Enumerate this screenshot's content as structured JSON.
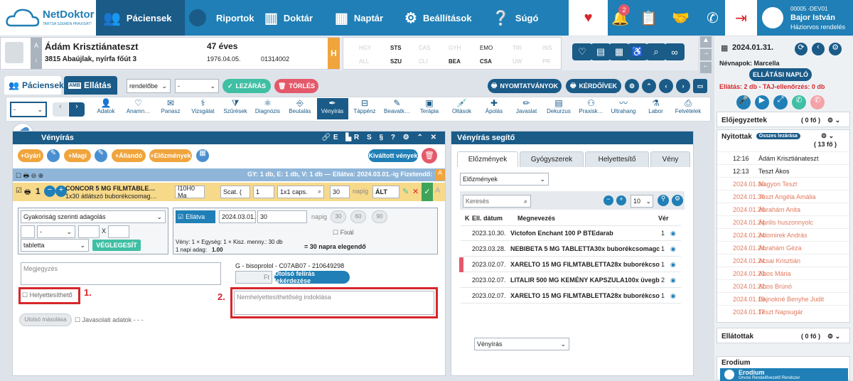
{
  "nav": {
    "logo": "NetDoktor",
    "logo_sub": "TARTSA SZEMÉN PRAXISÁT!",
    "items": [
      "Páciensek",
      "Riportok",
      "Doktár",
      "Naptár",
      "Beállítások",
      "Súgó"
    ],
    "badge": "2",
    "user_id": "00005 -DEV01",
    "user_name": "Bajor István",
    "user_role": "Háziorvos rendelés"
  },
  "patient": {
    "name": "Ádám Krisztiánateszt",
    "address": "3815 Abaújlak, nyírfa főút 3",
    "age": "47 éves",
    "dob": "1976.04.05.",
    "taj": "01314002",
    "h": "H"
  },
  "vitals": {
    "row1": [
      "HGY",
      "STS",
      "CAS",
      "GYH",
      "EMO",
      "TRI",
      "INS"
    ],
    "row2": [
      "ALL",
      "SZU",
      "CLI",
      "BEA",
      "CSA",
      "UW",
      "PR"
    ],
    "active1": [
      1,
      4
    ],
    "active2": [
      1,
      3,
      4
    ]
  },
  "tabs": {
    "pacients": "Páciensek",
    "ellatas": "Ellátás",
    "amb": "AMB",
    "select1": "rendelőbe",
    "select2": "-",
    "lezaras": "LEZÁRÁS",
    "torles": "TÖRLÉS",
    "nyomtatvanyok": "NYOMTATVÁNYOK",
    "kerdoivek": "KÉRDŐÍVEK",
    "sel3": "-"
  },
  "tools": [
    "Adatok",
    "Anamn…",
    "Panasz",
    "Vizsgálat",
    "Szűrések",
    "Diagnózis",
    "Beutalás",
    "Vényírás",
    "Táppénz",
    "Beavatk…",
    "Terápia",
    "Oltások",
    "Ápolás",
    "Javaslat",
    "Dekurzus",
    "Praxisk…",
    "Ultrahang",
    "Labor",
    "Felvételek"
  ],
  "ven": {
    "title": "Vényírás",
    "btns": [
      "+Gyári",
      "+Magi",
      "+Állandó",
      "+Előzmények"
    ],
    "kivalt": "Kiváltott vények",
    "summary": "GY: 1 db, E: 1 db, V: 1 db — Ellátva: 2024.03.01.-ig  Fizetendő: ?",
    "drug_name": "CONCOR 5 MG FILMTABLE…",
    "drug_sub": "1x30 átlátszó buborékcsomag…",
    "qty": "1",
    "code": "I10H0 Ma",
    "scat": "Scat. (",
    "n": "1",
    "caps": "1x1 caps.",
    "days": "30",
    "napig": "napig",
    "alt": "ÁLT",
    "dose": "Gyakoriság szerinti adagolás",
    "x": "X",
    "form": "tabletta",
    "veglegesit": "VÉGLEGESÍT",
    "ellatva": "Ellátva",
    "date": "2024.03.01.",
    "d30": "30",
    "p30": "30",
    "p60": "60",
    "p90": "90",
    "fixal": "Fixál",
    "veny_line": "Vény: 1 × Egység: 1 × Kisz. menny.: 30 db",
    "napi": "1 napi adag:",
    "napi_val": "1.00",
    "elegendo": "= 30 napra elegendő",
    "megjegyzes": "Megjegyzés",
    "atc": "G - bisoprolol - C07AB07 - 210649298",
    "ft": "Ft",
    "utolso": "Utolsó felírás lekérdezése",
    "helyettesitheto": "Helyettesíthető",
    "nem_indok": "Nemhelyettesíthetőség indoklása",
    "utolso_masolasa": "Utolsó másolása",
    "javasolati": "Javasolati adatok - - -",
    "m1": "1.",
    "m2": "2."
  },
  "seg": {
    "title": "Vényírás segítő",
    "tabs": [
      "Előzmények",
      "Gyógyszerek",
      "Helyettesítő",
      "Vény"
    ],
    "sel": "Előzmények",
    "search": "Keresés",
    "perpage": "10",
    "col_k": "K",
    "col_date": "Ell. dátum",
    "col_name": "Megnevezés",
    "col_ver": "Vér",
    "rows": [
      {
        "date": "2023.10.30.",
        "name": "Victofon Enchant 100 P BTEdarab",
        "n": "1"
      },
      {
        "date": "2023.03.28.",
        "name": "NEBIBETA 5 MG TABLETTA30x buborékcsomagc",
        "n": "1"
      },
      {
        "date": "2023.02.07.",
        "name": "XARELTO 15 MG FILMTABLETTA28x buborékcso",
        "n": "1"
      },
      {
        "date": "2023.02.07.",
        "name": "LITALIR 500 MG KEMÉNY KAPSZULA100x üvegb",
        "n": "2"
      },
      {
        "date": "2023.02.07.",
        "name": "XARELTO 15 MG FILMTABLETTA28x buborékcso",
        "n": "1"
      }
    ],
    "bottom_sel": "Vényírás"
  },
  "right": {
    "date": "2024.01.31.",
    "nevnapok": "Névnapok: Marcella",
    "naplo": "ELLÁTÁSI NAPLÓ",
    "warn": "Ellátás: 2 db - TAJ-ellenőrzés: 0 db",
    "elojegyzettek": "Előjegyzettek",
    "elo_count": "( 0 fő )",
    "nyitottak": "Nyitottak",
    "osszes": "Összes lezárása",
    "nyit_count": "( 13 fő )",
    "list": [
      {
        "t": "12:16",
        "n": "Ádám Krisztiánateszt",
        "pink": false
      },
      {
        "t": "12:13",
        "n": "Teszt Ákos",
        "pink": false
      },
      {
        "t": "2024.01.30.",
        "n": "Nagyon Teszt",
        "pink": true
      },
      {
        "t": "2024.01.30.",
        "n": "Teszt Angéla Amália",
        "pink": true
      },
      {
        "t": "2024.01.26.",
        "n": "Ábrahám Anita",
        "pink": true
      },
      {
        "t": "2024.01.24.",
        "n": "Április huszonnyolc",
        "pink": true
      },
      {
        "t": "2024.01.24.",
        "n": "Adomirek András",
        "pink": true
      },
      {
        "t": "2024.01.24.",
        "n": "Ábrahám Géza",
        "pink": true
      },
      {
        "t": "2024.01.24.",
        "n": "Acsai Krisztián",
        "pink": true
      },
      {
        "t": "2024.01.23.",
        "n": "Abos Mária",
        "pink": true
      },
      {
        "t": "2024.01.22.",
        "n": "Abos Brúnó",
        "pink": true
      },
      {
        "t": "2024.01.19.",
        "n": "Bajnokné Benyhe Judit",
        "pink": true
      },
      {
        "t": "2024.01.17.",
        "n": "Teszt Napsugár",
        "pink": true
      }
    ],
    "ellatottak": "Ellátottak",
    "ella_count": "( 0 fő )",
    "erodium": "Erodium",
    "erodium_sub": "Erodium",
    "erodium_sub2": "Orvosi Rendelővezető Rendszer"
  }
}
